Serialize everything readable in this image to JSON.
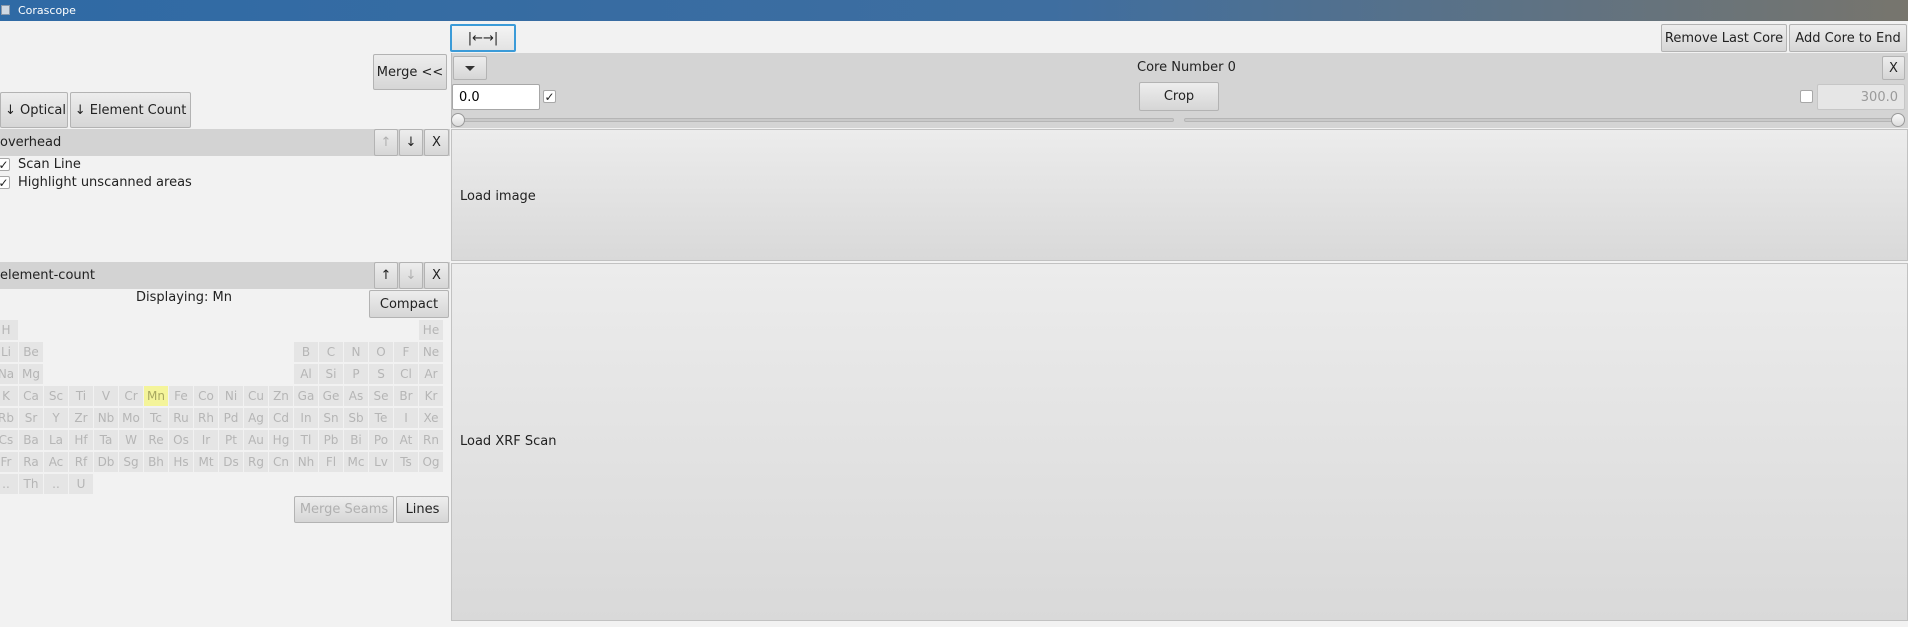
{
  "window": {
    "title": "Corascope"
  },
  "toolbar": {
    "shift_label": "|←→|",
    "remove_last_core": "Remove Last Core",
    "add_core_to_end": "Add Core to End",
    "merge": "Merge <<"
  },
  "left": {
    "optical_button": "↓ Optical",
    "element_count_button": "↓ Element Count",
    "overhead": {
      "title": "overhead",
      "up": "↑",
      "down": "↓",
      "close": "X",
      "options": [
        {
          "label": "Scan Line",
          "checked": true
        },
        {
          "label": "Highlight unscanned areas",
          "checked": true
        }
      ]
    },
    "element_count": {
      "title": "element-count",
      "up": "↑",
      "down": "↓",
      "close": "X",
      "displaying": "Displaying: Mn",
      "compact": "Compact",
      "merge_seams": "Merge Seams",
      "lines": "Lines",
      "selected": "Mn",
      "rows": [
        [
          "H",
          "",
          "",
          "",
          "",
          "",
          "",
          "",
          "",
          "",
          "",
          "",
          "",
          "",
          "",
          "",
          "",
          "He"
        ],
        [
          "Li",
          "Be",
          "",
          "",
          "",
          "",
          "",
          "",
          "",
          "",
          "",
          "",
          "B",
          "C",
          "N",
          "O",
          "F",
          "Ne"
        ],
        [
          "Na",
          "Mg",
          "",
          "",
          "",
          "",
          "",
          "",
          "",
          "",
          "",
          "",
          "Al",
          "Si",
          "P",
          "S",
          "Cl",
          "Ar"
        ],
        [
          "K",
          "Ca",
          "Sc",
          "Ti",
          "V",
          "Cr",
          "Mn",
          "Fe",
          "Co",
          "Ni",
          "Cu",
          "Zn",
          "Ga",
          "Ge",
          "As",
          "Se",
          "Br",
          "Kr"
        ],
        [
          "Rb",
          "Sr",
          "Y",
          "Zr",
          "Nb",
          "Mo",
          "Tc",
          "Ru",
          "Rh",
          "Pd",
          "Ag",
          "Cd",
          "In",
          "Sn",
          "Sb",
          "Te",
          "I",
          "Xe"
        ],
        [
          "Cs",
          "Ba",
          "La",
          "Hf",
          "Ta",
          "W",
          "Re",
          "Os",
          "Ir",
          "Pt",
          "Au",
          "Hg",
          "Tl",
          "Pb",
          "Bi",
          "Po",
          "At",
          "Rn"
        ],
        [
          "Fr",
          "Ra",
          "Ac",
          "Rf",
          "Db",
          "Sg",
          "Bh",
          "Hs",
          "Mt",
          "Ds",
          "Rg",
          "Cn",
          "Nh",
          "Fl",
          "Mc",
          "Lv",
          "Ts",
          "Og"
        ],
        [
          "..",
          "Th",
          "..",
          "U",
          "",
          "",
          "",
          "",
          "",
          "",
          "",
          "",
          "",
          "",
          "",
          "",
          "",
          ""
        ]
      ]
    }
  },
  "core": {
    "dropdown_icon": "triangle-down-icon",
    "title": "Core Number 0",
    "close": "X",
    "start_value": "0.0",
    "start_checked": true,
    "crop": "Crop",
    "end_value": "300.0",
    "end_checked": false,
    "load_image": "Load image",
    "load_xrf": "Load XRF Scan"
  }
}
